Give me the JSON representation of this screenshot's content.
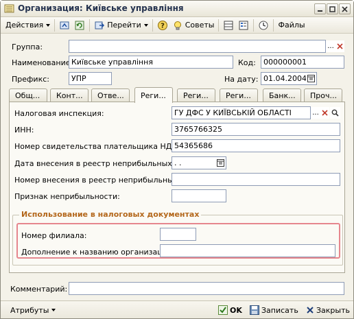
{
  "window": {
    "title": "Организация: Київське управління"
  },
  "toolbar": {
    "actions_label": "Действия",
    "goto_label": "Перейти",
    "tips_label": "Советы",
    "files_label": "Файлы"
  },
  "form": {
    "group_label": "Группа:",
    "group_value": "",
    "name_label": "Наименование:",
    "name_value": "Київське управління",
    "code_label": "Код:",
    "code_value": "000000001",
    "prefix_label": "Префикс:",
    "prefix_value": "УПР",
    "date_label": "На дату:",
    "date_value": "01.04.2004"
  },
  "tabs": [
    {
      "label": "Общ..."
    },
    {
      "label": "Конт..."
    },
    {
      "label": "Отве..."
    },
    {
      "label": "Реги..."
    },
    {
      "label": "Реги..."
    },
    {
      "label": "Реги..."
    },
    {
      "label": "Банк..."
    },
    {
      "label": "Проч..."
    }
  ],
  "panel": {
    "tax_office_label": "Налоговая инспекция:",
    "tax_office_value": "ГУ ДФС У КИЇВСЬКІЙ ОБЛАСТІ",
    "inn_label": "ИНН:",
    "inn_value": "3765766325",
    "vat_cert_label": "Номер свидетельства плательщика НДС:",
    "vat_cert_value": "54365686",
    "nonprofit_date_label": "Дата внесения в реестр неприбыльных:",
    "nonprofit_date_value": " .  .",
    "nonprofit_number_label": "Номер внесения в реестр неприбыльных:",
    "nonprofit_number_value": "",
    "nonprofit_sign_label": "Признак неприбыльности:",
    "nonprofit_sign_value": "",
    "tax_docs_group_title": "Использование в налоговых документах",
    "branch_number_label": "Номер филиала:",
    "branch_number_value": "",
    "name_addition_label": "Дополнение к названию организации:",
    "name_addition_value": ""
  },
  "comment": {
    "label": "Комментарий:",
    "value": ""
  },
  "footer": {
    "attributes_label": "Атрибуты",
    "ok_label": "OK",
    "save_label": "Записать",
    "close_label": "Закрыть"
  }
}
